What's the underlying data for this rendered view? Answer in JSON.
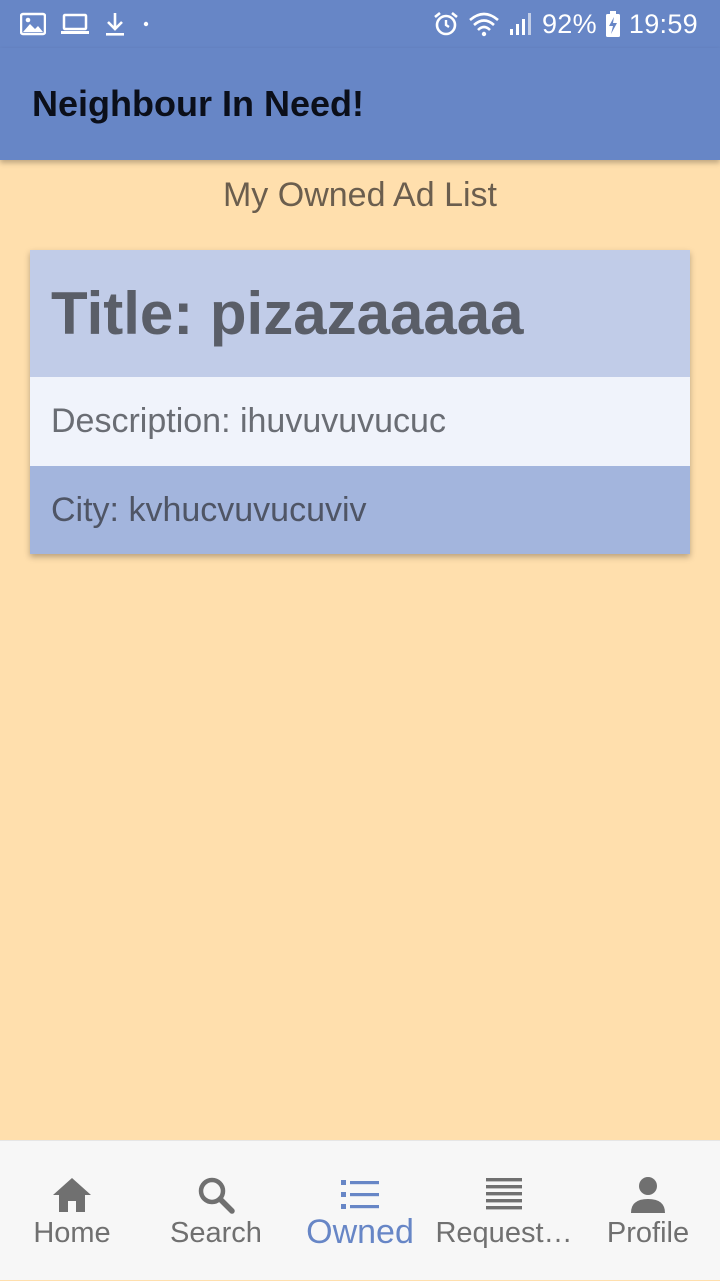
{
  "status_bar": {
    "battery": "92%",
    "time": "19:59",
    "left_icons": [
      "image-icon",
      "laptop-icon",
      "download-icon",
      "dot-icon"
    ],
    "right_icons": [
      "alarm-icon",
      "wifi-icon",
      "signal-icon",
      "battery-charging-icon"
    ]
  },
  "app_bar": {
    "title": "Neighbour In Need!"
  },
  "page": {
    "heading": "My Owned Ad List"
  },
  "ads": [
    {
      "title": "Title: pizazaaaaa",
      "description": "Description: ihuvuvuvucuc",
      "city": "City: kvhucvuvucuviv"
    }
  ],
  "bottom_nav": {
    "items": [
      {
        "label": "Home",
        "icon": "home-icon",
        "active": false
      },
      {
        "label": "Search",
        "icon": "search-icon",
        "active": false
      },
      {
        "label": "Owned",
        "icon": "list-icon",
        "active": true
      },
      {
        "label": "Request…",
        "icon": "lines-icon",
        "active": false
      },
      {
        "label": "Profile",
        "icon": "person-icon",
        "active": false
      }
    ]
  },
  "colors": {
    "primary": "#6786C6",
    "background": "#FFDFAD",
    "card_title_bg": "#C1CCE8",
    "card_desc_bg": "#F0F3FB",
    "card_city_bg": "#A3B5DD",
    "nav_bg": "#F7F7F7"
  }
}
